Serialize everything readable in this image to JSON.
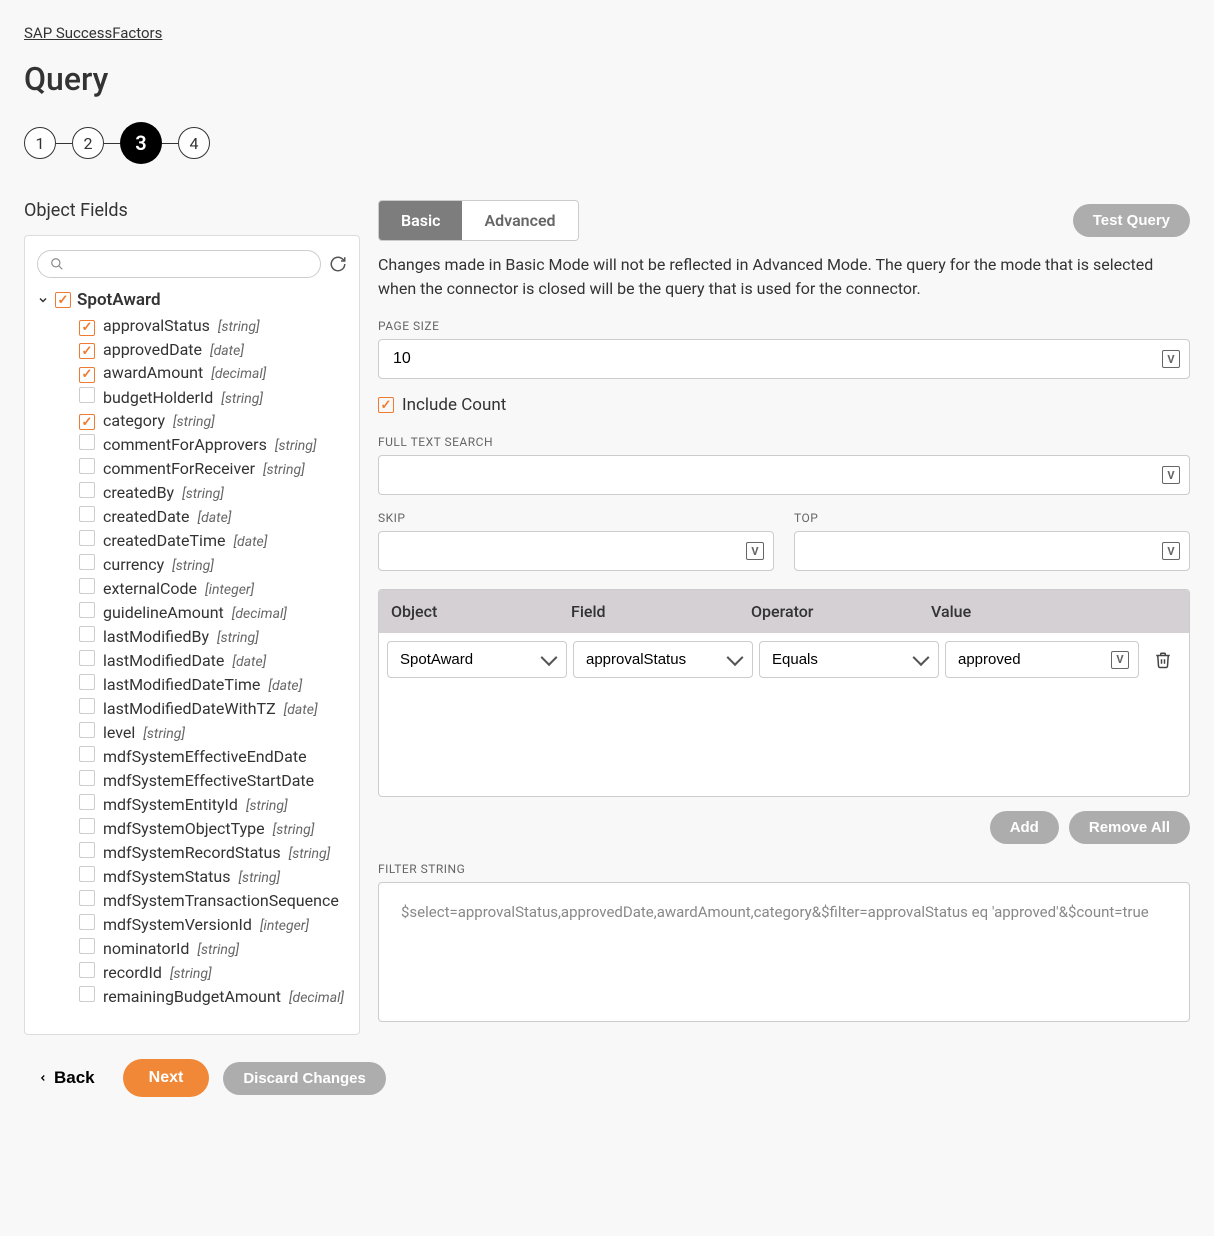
{
  "breadcrumb": "SAP SuccessFactors",
  "title": "Query",
  "steps": [
    "1",
    "2",
    "3",
    "4"
  ],
  "activeStep": 2,
  "leftTitle": "Object Fields",
  "tree": {
    "root": "SpotAward",
    "rootChecked": true,
    "fields": [
      {
        "name": "approvalStatus",
        "type": "[string]",
        "checked": true
      },
      {
        "name": "approvedDate",
        "type": "[date]",
        "checked": true
      },
      {
        "name": "awardAmount",
        "type": "[decimal]",
        "checked": true
      },
      {
        "name": "budgetHolderId",
        "type": "[string]",
        "checked": false
      },
      {
        "name": "category",
        "type": "[string]",
        "checked": true
      },
      {
        "name": "commentForApprovers",
        "type": "[string]",
        "checked": false
      },
      {
        "name": "commentForReceiver",
        "type": "[string]",
        "checked": false
      },
      {
        "name": "createdBy",
        "type": "[string]",
        "checked": false
      },
      {
        "name": "createdDate",
        "type": "[date]",
        "checked": false
      },
      {
        "name": "createdDateTime",
        "type": "[date]",
        "checked": false
      },
      {
        "name": "currency",
        "type": "[string]",
        "checked": false
      },
      {
        "name": "externalCode",
        "type": "[integer]",
        "checked": false
      },
      {
        "name": "guidelineAmount",
        "type": "[decimal]",
        "checked": false
      },
      {
        "name": "lastModifiedBy",
        "type": "[string]",
        "checked": false
      },
      {
        "name": "lastModifiedDate",
        "type": "[date]",
        "checked": false
      },
      {
        "name": "lastModifiedDateTime",
        "type": "[date]",
        "checked": false
      },
      {
        "name": "lastModifiedDateWithTZ",
        "type": "[date]",
        "checked": false
      },
      {
        "name": "level",
        "type": "[string]",
        "checked": false
      },
      {
        "name": "mdfSystemEffectiveEndDate",
        "type": "",
        "checked": false
      },
      {
        "name": "mdfSystemEffectiveStartDate",
        "type": "",
        "checked": false
      },
      {
        "name": "mdfSystemEntityId",
        "type": "[string]",
        "checked": false
      },
      {
        "name": "mdfSystemObjectType",
        "type": "[string]",
        "checked": false
      },
      {
        "name": "mdfSystemRecordStatus",
        "type": "[string]",
        "checked": false
      },
      {
        "name": "mdfSystemStatus",
        "type": "[string]",
        "checked": false
      },
      {
        "name": "mdfSystemTransactionSequence",
        "type": "",
        "checked": false
      },
      {
        "name": "mdfSystemVersionId",
        "type": "[integer]",
        "checked": false
      },
      {
        "name": "nominatorId",
        "type": "[string]",
        "checked": false
      },
      {
        "name": "recordId",
        "type": "[string]",
        "checked": false
      },
      {
        "name": "remainingBudgetAmount",
        "type": "[decimal]",
        "checked": false
      }
    ]
  },
  "tabs": {
    "basic": "Basic",
    "advanced": "Advanced"
  },
  "testQuery": "Test Query",
  "note": "Changes made in Basic Mode will not be reflected in Advanced Mode. The query for the mode that is selected when the connector is closed will be the query that is used for the connector.",
  "labels": {
    "pageSize": "PAGE SIZE",
    "includeCount": "Include Count",
    "fullText": "FULL TEXT SEARCH",
    "skip": "SKIP",
    "top": "TOP",
    "filterString": "FILTER STRING"
  },
  "values": {
    "pageSize": "10",
    "fullText": "",
    "skip": "",
    "top": "",
    "filterString": "$select=approvalStatus,approvedDate,awardAmount,category&$filter=approvalStatus eq 'approved'&$count=true"
  },
  "filterHead": {
    "object": "Object",
    "field": "Field",
    "operator": "Operator",
    "value": "Value"
  },
  "filterRow": {
    "object": "SpotAward",
    "field": "approvalStatus",
    "operator": "Equals",
    "value": "approved"
  },
  "buttons": {
    "add": "Add",
    "removeAll": "Remove All",
    "back": "Back",
    "next": "Next",
    "discard": "Discard Changes"
  }
}
